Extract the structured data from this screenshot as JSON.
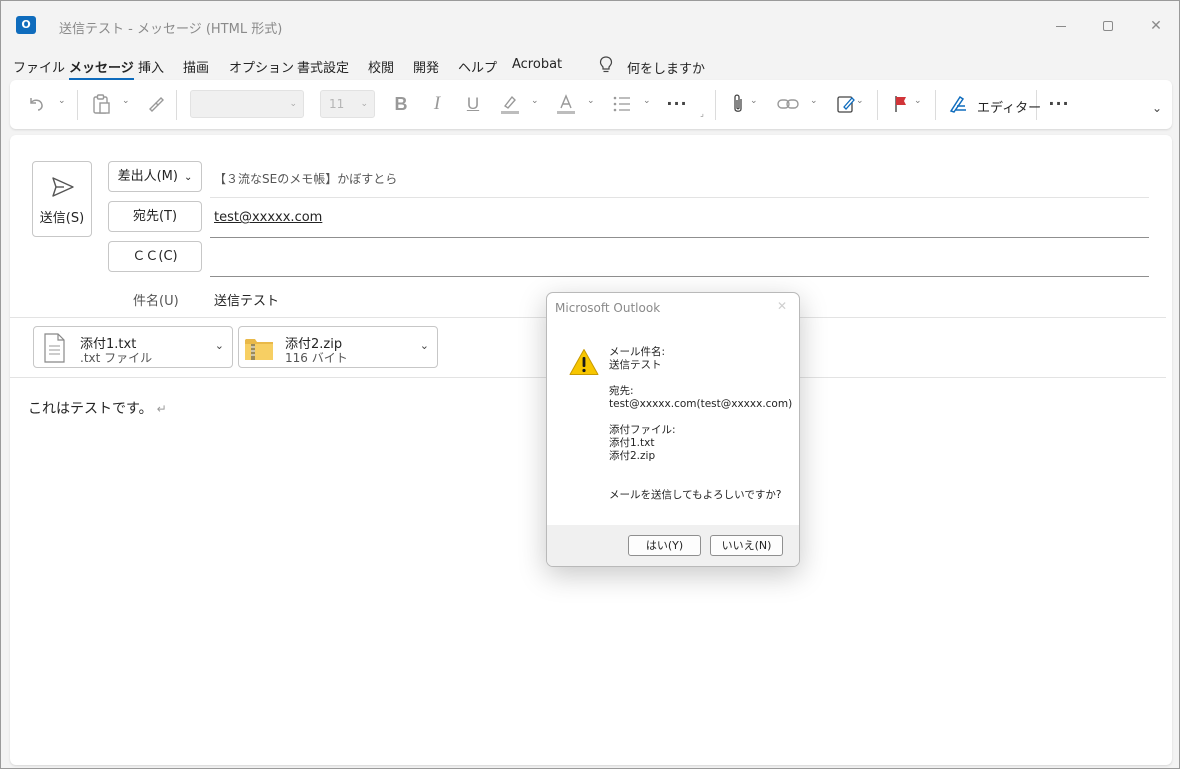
{
  "window": {
    "title": "送信テスト  -  メッセージ (HTML 形式)",
    "app_icon_letter": "O"
  },
  "menu": {
    "items": [
      "ファイル",
      "メッセージ",
      "挿入",
      "描画",
      "オプション",
      "書式設定",
      "校閲",
      "開発",
      "ヘルプ",
      "Acrobat"
    ],
    "active": "メッセージ",
    "tell_me": "何をしますか"
  },
  "ribbon": {
    "font_size": "11",
    "editor_label": "エディター",
    "icons": [
      "undo-icon",
      "paste-icon",
      "format-painter-icon",
      "bold-icon",
      "italic-icon",
      "underline-icon",
      "highlight-icon",
      "font-color-icon",
      "bullets-icon",
      "more-icon",
      "attach-icon",
      "link-icon",
      "signature-icon",
      "flag-icon",
      "editor-icon",
      "overflow-icon",
      "collapse-icon"
    ]
  },
  "compose": {
    "send_label": "送信(S)",
    "from_button": "差出人(M)",
    "from_value": "【３流なSEのメモ帳】かぼすとら",
    "to_button": "宛先(T)",
    "to_value": "test@xxxxx.com",
    "cc_button": "ＣＣ(C)",
    "cc_value": "",
    "subject_label": "件名(U)",
    "subject_value": "送信テスト",
    "body": "これはテストです。",
    "body_return_mark": "↵"
  },
  "attachments": [
    {
      "name": "添付1.txt",
      "detail": ".txt ファイル",
      "icon": "text-file-icon"
    },
    {
      "name": "添付2.zip",
      "detail": "116 バイト",
      "icon": "zip-folder-icon"
    }
  ],
  "dialog": {
    "title": "Microsoft Outlook",
    "lines": [
      "メール件名:",
      "送信テスト",
      "",
      "宛先:",
      "test@xxxxx.com(test@xxxxx.com)",
      "",
      "添付ファイル:",
      "添付1.txt",
      "添付2.zip",
      "",
      "",
      "メールを送信してもよろしいですか?"
    ],
    "yes_button": "はい(Y)",
    "no_button": "いいえ(N)"
  },
  "colors": {
    "accent": "#0f6cbd",
    "warning": "#f7c600",
    "flag": "#d13438"
  }
}
